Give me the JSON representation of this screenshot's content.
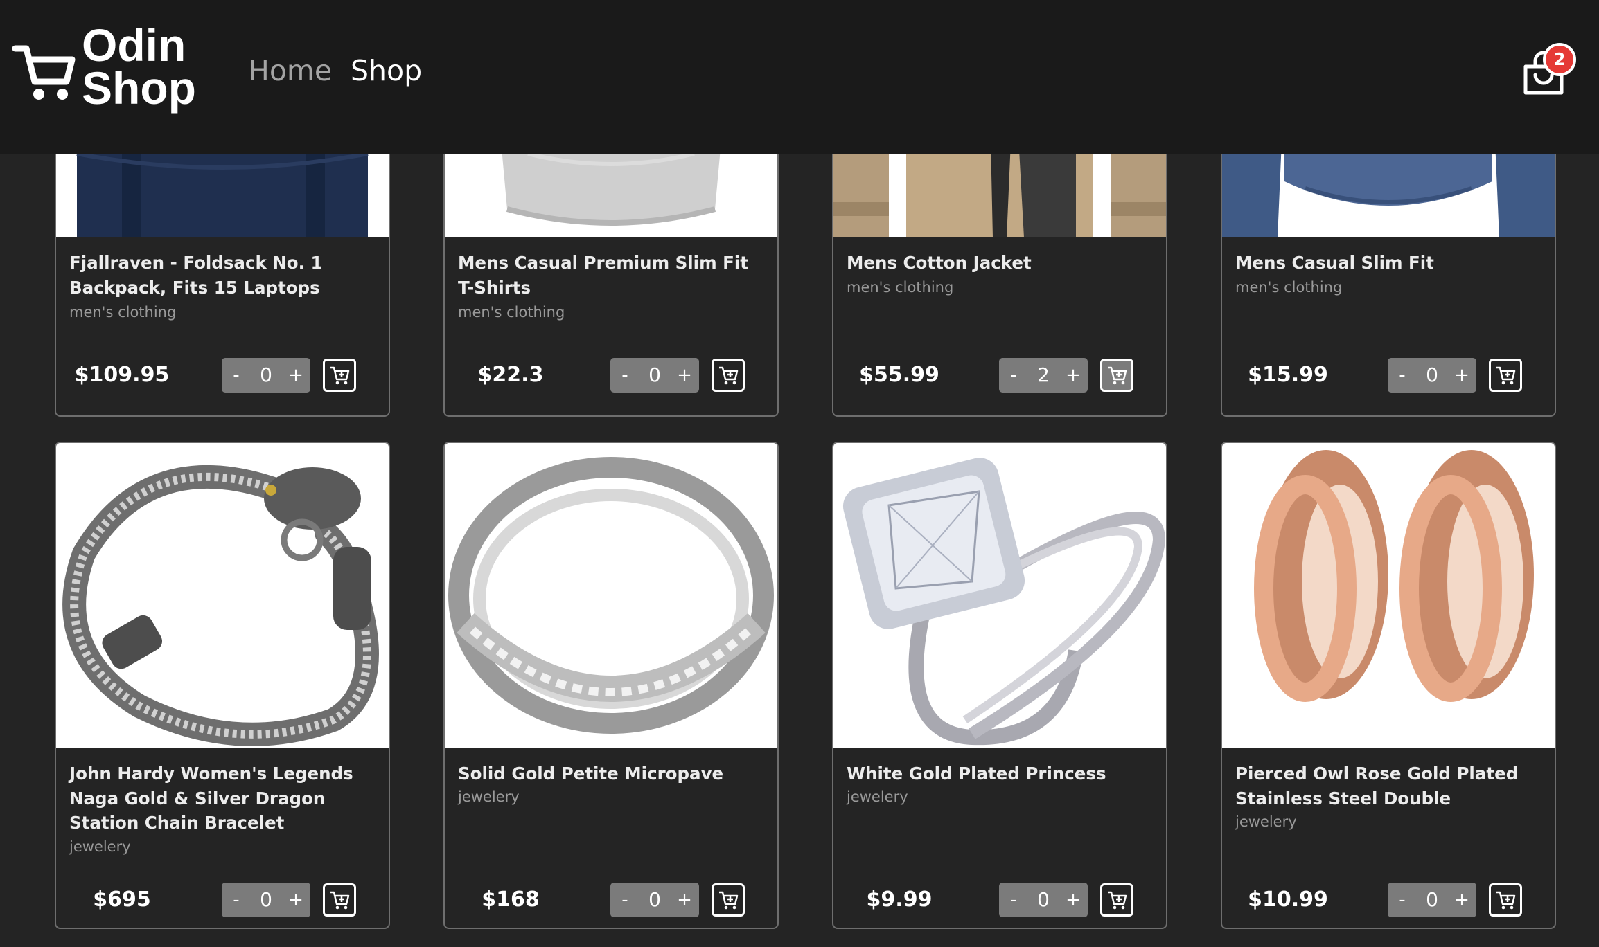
{
  "header": {
    "logo_line1": "Odin",
    "logo_line2": "Shop",
    "nav": {
      "home": "Home",
      "shop": "Shop"
    },
    "cart_count": "2"
  },
  "products": [
    {
      "title": "Fjallraven - Foldsack No. 1 Backpack, Fits 15 Laptops",
      "category": "men's clothing",
      "price": "$109.95",
      "qty": "0",
      "dec": "-",
      "inc": "+"
    },
    {
      "title": "Mens Casual Premium Slim Fit T-Shirts",
      "category": "men's clothing",
      "price": "$22.3",
      "qty": "0",
      "dec": "-",
      "inc": "+"
    },
    {
      "title": "Mens Cotton Jacket",
      "category": "men's clothing",
      "price": "$55.99",
      "qty": "2",
      "dec": "-",
      "inc": "+"
    },
    {
      "title": "Mens Casual Slim Fit",
      "category": "men's clothing",
      "price": "$15.99",
      "qty": "0",
      "dec": "-",
      "inc": "+"
    },
    {
      "title": "John Hardy Women's Legends Naga Gold & Silver Dragon Station Chain Bracelet",
      "category": "jewelery",
      "price": "$695",
      "qty": "0",
      "dec": "-",
      "inc": "+"
    },
    {
      "title": "Solid Gold Petite Micropave",
      "category": "jewelery",
      "price": "$168",
      "qty": "0",
      "dec": "-",
      "inc": "+"
    },
    {
      "title": "White Gold Plated Princess",
      "category": "jewelery",
      "price": "$9.99",
      "qty": "0",
      "dec": "-",
      "inc": "+"
    },
    {
      "title": "Pierced Owl Rose Gold Plated Stainless Steel Double",
      "category": "jewelery",
      "price": "$10.99",
      "qty": "0",
      "dec": "-",
      "inc": "+"
    }
  ],
  "colors": {
    "header_bg": "#1a1a1a",
    "page_bg": "#242424",
    "badge": "#e53935",
    "qty_bg": "#7b7b7b"
  },
  "icons": {
    "logo": "shopping-cart-icon",
    "cart": "shopping-bag-icon",
    "add": "cart-plus-icon"
  }
}
